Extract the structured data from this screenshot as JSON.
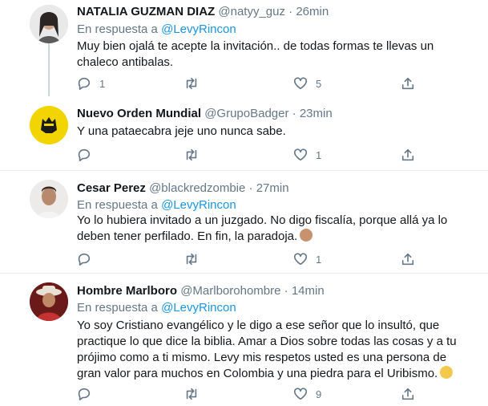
{
  "tweets": [
    {
      "name": "NATALIA GUZMAN DIAZ",
      "handle": "@natyy_guz",
      "time": "26min",
      "reply_prefix": "En respuesta a",
      "reply_to": "@LevyRincon",
      "text": "Muy bien ojalá te acepte la invitación.. de todas formas te llevas un chaleco antibalas.",
      "replies": "1",
      "retweets": "",
      "likes": "5"
    },
    {
      "name": "Nuevo Orden Mundial",
      "handle": "@GrupoBadger",
      "time": "23min",
      "text": "Y una pataecabra jeje uno nunca sabe.",
      "replies": "",
      "retweets": "",
      "likes": "1"
    },
    {
      "name": "Cesar Perez",
      "handle": "@blackredzombie",
      "time": "27min",
      "reply_prefix": "En respuesta a",
      "reply_to": "@LevyRincon",
      "text": "Yo lo hubiera invitado a un juzgado. No digo fiscalía, porque allá ya lo deben tener perfilado. En fin, la paradoja.",
      "replies": "",
      "retweets": "",
      "likes": "1"
    },
    {
      "name": "Hombre Marlboro",
      "handle": "@Marlborohombre",
      "time": "14min",
      "reply_prefix": "En respuesta a",
      "reply_to": "@LevyRincon",
      "text": "Yo soy Cristiano evangélico y le digo a ese señor que lo insultó, que practique lo que dice la biblia. Amar a Dios sobre todas las cosas y a tu prójimo como a ti mismo. Levy mis respetos usted es una persona de gran valor para muchos en Colombia y una piedra para el Uribismo.",
      "replies": "",
      "retweets": "",
      "likes": "9"
    }
  ],
  "separator": "·",
  "icons": {
    "reply": "reply-icon",
    "retweet": "retweet-icon",
    "like": "heart-icon",
    "share": "share-icon"
  },
  "colors": {
    "link": "#1b95e0",
    "secondary": "#657786",
    "divider": "#e6ecf0"
  }
}
